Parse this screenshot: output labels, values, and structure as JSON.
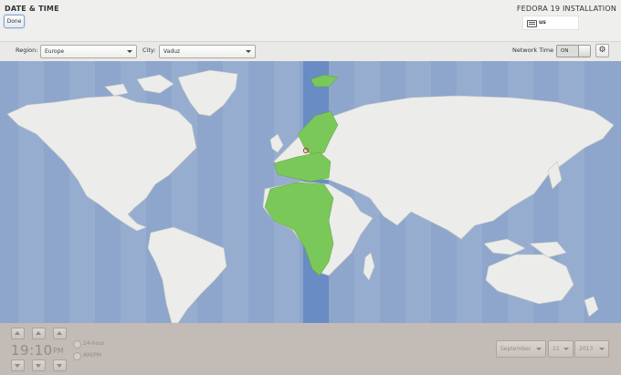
{
  "header": {
    "title": "DATE & TIME",
    "done_label": "Done",
    "installer_title": "FEDORA 19 INSTALLATION",
    "keyboard_layout": "us"
  },
  "toolbar": {
    "region_label": "Region:",
    "region_value": "Europe",
    "city_label": "City:",
    "city_value": "Vaduz",
    "network_time_label": "Network Time",
    "network_time_state": "ON"
  },
  "map": {
    "selected_timezone_color": "#7ac85a",
    "highlight_band_color": "#6a8cc4",
    "ocean_color": "#8ea6cb",
    "land_color": "#ececea"
  },
  "time_panel": {
    "time": "19:10",
    "meridiem": "PM",
    "format_24": "24-hour",
    "format_ampm": "AM/PM"
  },
  "date_panel": {
    "month": "September",
    "day": "11",
    "year": "2013"
  }
}
